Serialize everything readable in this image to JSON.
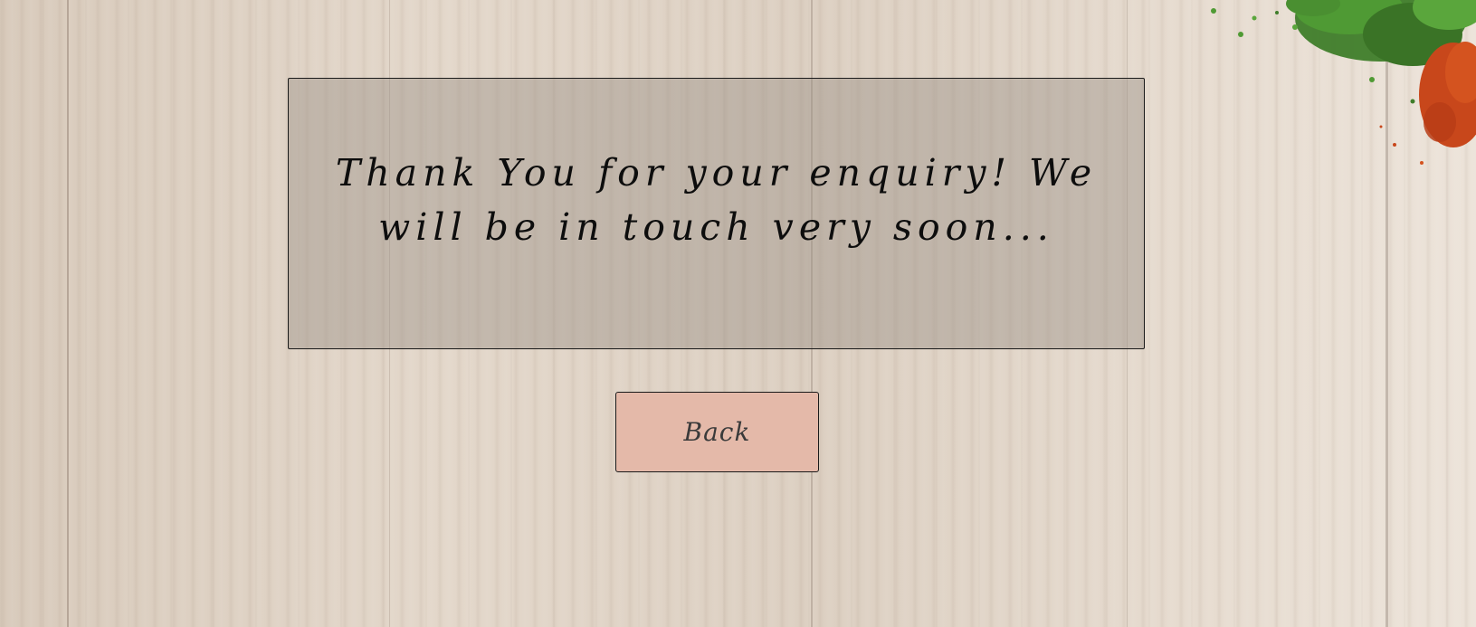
{
  "message": {
    "text": "Thank You for your enquiry! We will be in touch very soon..."
  },
  "actions": {
    "back_label": "Back"
  }
}
